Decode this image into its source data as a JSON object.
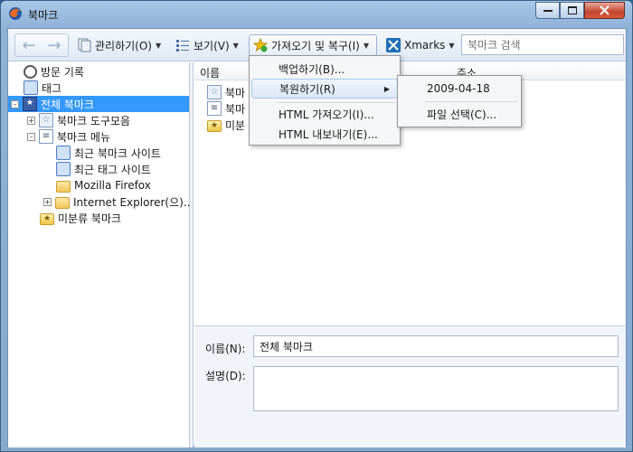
{
  "window": {
    "title": "북마크"
  },
  "toolbar": {
    "organize_label": "관리하기(O)",
    "views_label": "보기(V)",
    "import_backup_label": "가져오기 및 복구(I)",
    "xmarks_label": "Xmarks",
    "search_placeholder": "북마크 검색"
  },
  "tree": {
    "items": [
      {
        "label": "방문 기록"
      },
      {
        "label": "태그"
      },
      {
        "label": "전체 북마크"
      },
      {
        "label": "북마크 도구모음"
      },
      {
        "label": "북마크 메뉴"
      },
      {
        "label": "최근 북마크 사이트"
      },
      {
        "label": "최근 태그 사이트"
      },
      {
        "label": "Mozilla Firefox"
      },
      {
        "label": "Internet Explorer(으)..."
      },
      {
        "label": "미분류 북마크"
      }
    ]
  },
  "list": {
    "columns": [
      "이름",
      "주소"
    ],
    "rows": [
      {
        "name": "북마"
      },
      {
        "name": "북마"
      },
      {
        "name": "미분"
      }
    ]
  },
  "details": {
    "name_label": "이름(N):",
    "name_value": "전체 북마크",
    "desc_label": "설명(D):",
    "desc_value": ""
  },
  "menu": {
    "items": [
      {
        "label": "백업하기(B)..."
      },
      {
        "label": "복원하기(R)"
      },
      {
        "label": "HTML 가져오기(I)..."
      },
      {
        "label": "HTML 내보내기(E)..."
      }
    ]
  },
  "submenu": {
    "items": [
      {
        "label": "2009-04-18"
      },
      {
        "label": "파일 선택(C)..."
      }
    ]
  },
  "colors": {
    "selection": "#3399ff",
    "titlebar": "#a9c7e6"
  }
}
